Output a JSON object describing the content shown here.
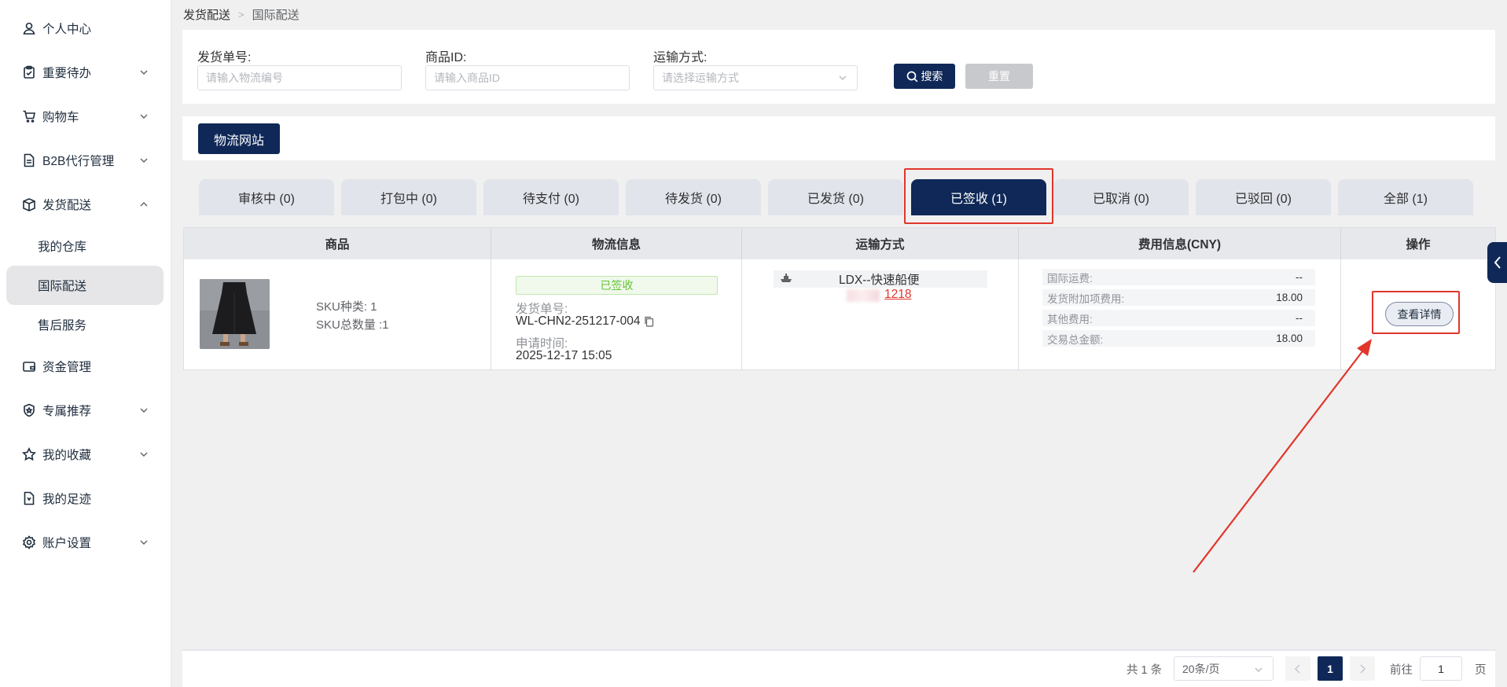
{
  "sidebar": {
    "items": [
      {
        "label": "个人中心",
        "icon": "user-icon",
        "chevron": false
      },
      {
        "label": "重要待办",
        "icon": "clipboard-icon",
        "chevron": true
      },
      {
        "label": "购物车",
        "icon": "cart-icon",
        "chevron": true
      },
      {
        "label": "B2B代行管理",
        "icon": "document-icon",
        "chevron": true
      },
      {
        "label": "发货配送",
        "icon": "box-icon",
        "chevron": true,
        "expanded": true
      },
      {
        "label": "资金管理",
        "icon": "wallet-icon",
        "chevron": false
      },
      {
        "label": "专属推荐",
        "icon": "badge-icon",
        "chevron": true
      },
      {
        "label": "我的收藏",
        "icon": "star-icon",
        "chevron": true
      },
      {
        "label": "我的足迹",
        "icon": "footprint-icon",
        "chevron": false
      },
      {
        "label": "账户设置",
        "icon": "gear-icon",
        "chevron": true
      }
    ],
    "subitems": [
      {
        "label": "我的仓库",
        "active": false
      },
      {
        "label": "国际配送",
        "active": true
      },
      {
        "label": "售后服务",
        "active": false
      }
    ]
  },
  "breadcrumb": {
    "first": "发货配送",
    "current": "国际配送"
  },
  "filter": {
    "order_label": "发货单号:",
    "order_placeholder": "请输入物流编号",
    "product_label": "商品ID:",
    "product_placeholder": "请输入商品ID",
    "shipping_label": "运输方式:",
    "shipping_placeholder": "请选择运输方式",
    "search_label": "搜索",
    "reset_label": "重置"
  },
  "toolbar": {
    "site_label": "物流网站"
  },
  "tabs": [
    {
      "label": "审核中 (0)",
      "active": false
    },
    {
      "label": "打包中 (0)",
      "active": false
    },
    {
      "label": "待支付 (0)",
      "active": false
    },
    {
      "label": "待发货 (0)",
      "active": false
    },
    {
      "label": "已发货 (0)",
      "active": false
    },
    {
      "label": "已签收 (1)",
      "active": true
    },
    {
      "label": "已取消 (0)",
      "active": false
    },
    {
      "label": "已驳回 (0)",
      "active": false
    },
    {
      "label": "全部 (1)",
      "active": false
    }
  ],
  "table": {
    "headers": [
      "商品",
      "物流信息",
      "运输方式",
      "费用信息(CNY)",
      "操作"
    ],
    "row": {
      "sku_kinds": "SKU种类: 1",
      "sku_total": "SKU总数量 :1",
      "status": "已签收",
      "order_no_label": "发货单号:",
      "order_no": "WL-CHN2-251217-004",
      "apply_time_label": "申请时间:",
      "apply_time": "2025-12-17 15:05",
      "shipping_name": "LDX--快速船便",
      "tracking_visible": "1218",
      "fees": [
        {
          "label": "国际运费:",
          "value": "--"
        },
        {
          "label": "发货附加项费用:",
          "value": "18.00"
        },
        {
          "label": "其他费用:",
          "value": "--"
        },
        {
          "label": "交易总金额:",
          "value": "18.00"
        }
      ],
      "action_label": "查看详情"
    }
  },
  "pagination": {
    "total": "共 1 条",
    "page_size": "20条/页",
    "current": "1",
    "goto_label": "前往",
    "goto_value": "1",
    "page_suffix": "页"
  },
  "colors": {
    "brand": "#0f2857",
    "highlight": "#e0362c",
    "status_green": "#67c23a"
  }
}
